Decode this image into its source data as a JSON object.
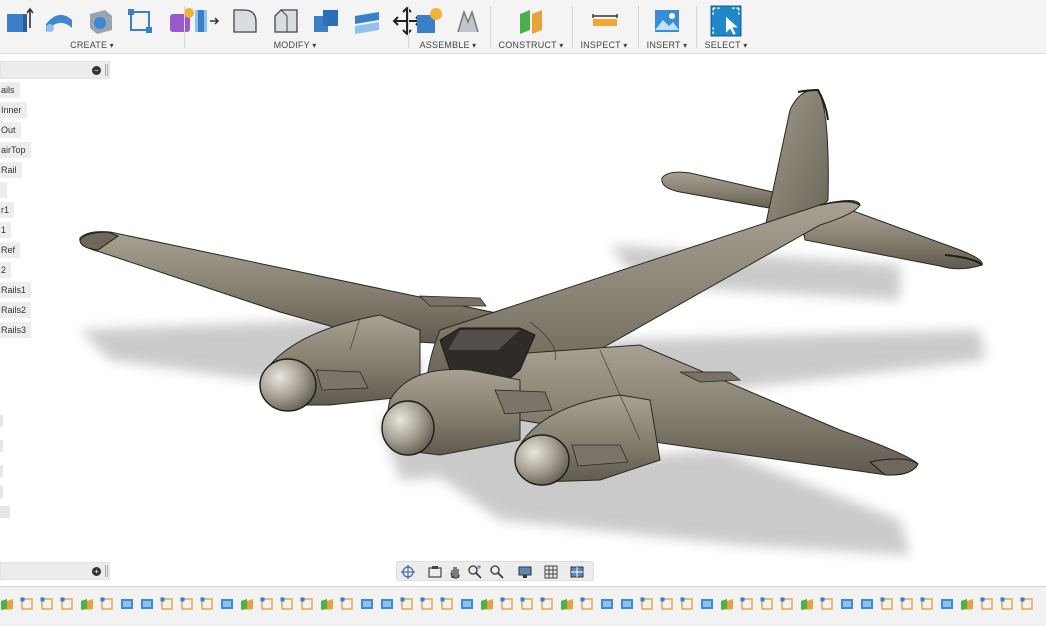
{
  "toolbar": {
    "groups": [
      {
        "label": "CREATE"
      },
      {
        "label": "MODIFY"
      },
      {
        "label": "ASSEMBLE"
      },
      {
        "label": "CONSTRUCT"
      },
      {
        "label": "INSPECT"
      },
      {
        "label": "INSERT"
      },
      {
        "label": "SELECT"
      }
    ]
  },
  "browser": {
    "items": [
      "ails",
      "Inner",
      "Out",
      "airTop",
      "Rail",
      "",
      "r1",
      "1",
      "Ref",
      "2",
      "Rails1",
      "Rails2",
      "Rails3"
    ]
  },
  "colors": {
    "accent": "#1e88c8",
    "model": "#8a8477",
    "toolbar_bg": "#f4f4f4"
  },
  "timeline": {
    "icon_count": 52
  }
}
